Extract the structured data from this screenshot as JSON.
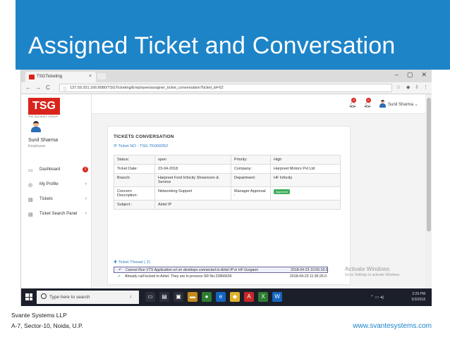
{
  "slide": {
    "title": "Assigned Ticket and Conversation",
    "footer_company": "Svante Systems LLP",
    "footer_address": "A-7, Sector-10, Noida, U.P.",
    "footer_website": "www.svantesystems.com",
    "colors": {
      "title_band": "#1d84c8",
      "brand_red": "#d9241c",
      "link_blue": "#2c7cc4",
      "approved_green": "#3cae5a"
    }
  },
  "browser": {
    "tab_title": "TSGTicketing",
    "tab_close": "×",
    "url": "137.59.201.166:8080/TSGTicketing/Employee/assigner_ticket_conversation?ticket_id=52",
    "window_controls": {
      "minimize": "–",
      "restore": "▢",
      "close": "✕"
    },
    "nav": {
      "back": "←",
      "forward": "→",
      "reload": "C"
    }
  },
  "app": {
    "logo_text": "TSG",
    "logo_subtitle": "THE SACHDEV GROUP",
    "user_name": "Sunil Sharma",
    "user_role": "Employee",
    "header_user": "Sunil Sharma ⌄",
    "notifications": [
      {
        "count": "0"
      },
      {
        "count": "0"
      }
    ],
    "sidebar": [
      {
        "label": "Dashboard",
        "icon": "monitor-icon",
        "badge": "1"
      },
      {
        "label": "My Profile",
        "icon": "profile-icon",
        "chevron": "›"
      },
      {
        "label": "Tickets",
        "icon": "ticket-icon",
        "chevron": "›"
      },
      {
        "label": "Ticket Search Panel",
        "icon": "search-panel-icon",
        "chevron": "›"
      }
    ]
  },
  "ticket": {
    "section_title": "TICKETS CONVERSATION",
    "ticket_no": "Ticket NO : TSG-TK000052",
    "rows": [
      {
        "l1": "Status:",
        "v1": "open",
        "l2": "Priority:",
        "v2": "High"
      },
      {
        "l1": "Ticket Date:",
        "v1": "23-04-2018",
        "l2": "Company:",
        "v2": "Harpreet Motors Pvt Ltd"
      },
      {
        "l1": "Branch:",
        "v1": "Harpreet Ford Infocity Showroom & Service",
        "l2": "Department:",
        "v2": "HF Infocity"
      },
      {
        "l1": "Concern Description:",
        "v1": "Networking Support",
        "l2": "Manager Approval :",
        "v2": "Approved"
      },
      {
        "l1": "Subject :",
        "v1": "Airtel IP"
      }
    ],
    "thread_label": "Ticket Thread ( 2)",
    "thread": [
      {
        "message": "Cannot Run VTS Application url on desktops connected to Airtel IP in HF Gurgaon",
        "date": "2018-04-23 10:55:18.0"
      },
      {
        "message": "Already call locked to Airtel. They are in process SR No:22866636",
        "date": "2018-04-23 11:35:25.0"
      }
    ]
  },
  "watermark": {
    "line1": "Activate Windows",
    "line2": "Go to Settings to activate Windows."
  },
  "taskbar": {
    "search_placeholder": "Type here to search",
    "time": "2:29 PM",
    "date": "5/3/2018"
  }
}
